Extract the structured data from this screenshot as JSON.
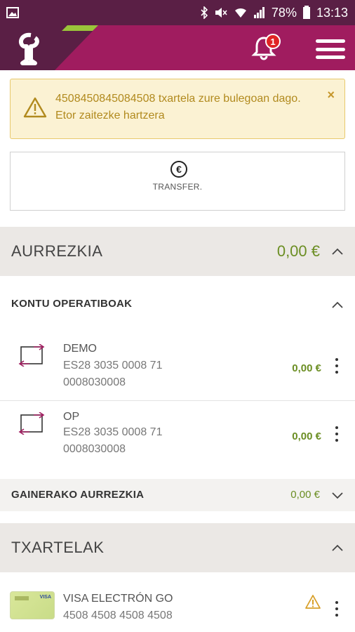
{
  "status_bar": {
    "battery": "78%",
    "time": "13:13"
  },
  "header": {
    "notification_count": "1"
  },
  "alert": {
    "message": "4508450845084508 txartela zure bulegoan dago. Etor zaitezke hartzera",
    "close": "×"
  },
  "transfer": {
    "symbol": "€",
    "label": "TRANSFER."
  },
  "savings": {
    "title": "AURREZKIA",
    "amount": "0,00 €",
    "operational": {
      "title": "KONTU OPERATIBOAK",
      "accounts": [
        {
          "name": "DEMO",
          "iban_line1": "ES28 3035 0008 71",
          "iban_line2": "0008030008",
          "amount": "0,00 €"
        },
        {
          "name": "OP",
          "iban_line1": "ES28 3035 0008 71",
          "iban_line2": "0008030008",
          "amount": "0,00 €"
        }
      ]
    },
    "other": {
      "title": "GAINERAKO AURREZKIA",
      "amount": "0,00 €"
    }
  },
  "cards": {
    "title": "TXARTELAK",
    "items": [
      {
        "name": "VISA ELECTRÓN GO",
        "number": "4508 4508 4508 4508",
        "brand": "VISA"
      }
    ]
  },
  "colors": {
    "header": "#a01c5f",
    "status_bar": "#5a1f45",
    "amount": "#6b8e23",
    "alert_text": "#b18a1e"
  },
  "icons": [
    "gallery-icon",
    "bluetooth-icon",
    "mute-icon",
    "wifi-icon",
    "signal-icon",
    "battery-icon",
    "bell-icon",
    "menu-icon",
    "warning-icon",
    "close-icon",
    "euro-icon",
    "transfer-account-icon",
    "chevron-up-icon",
    "chevron-down-icon",
    "kebab-icon"
  ]
}
